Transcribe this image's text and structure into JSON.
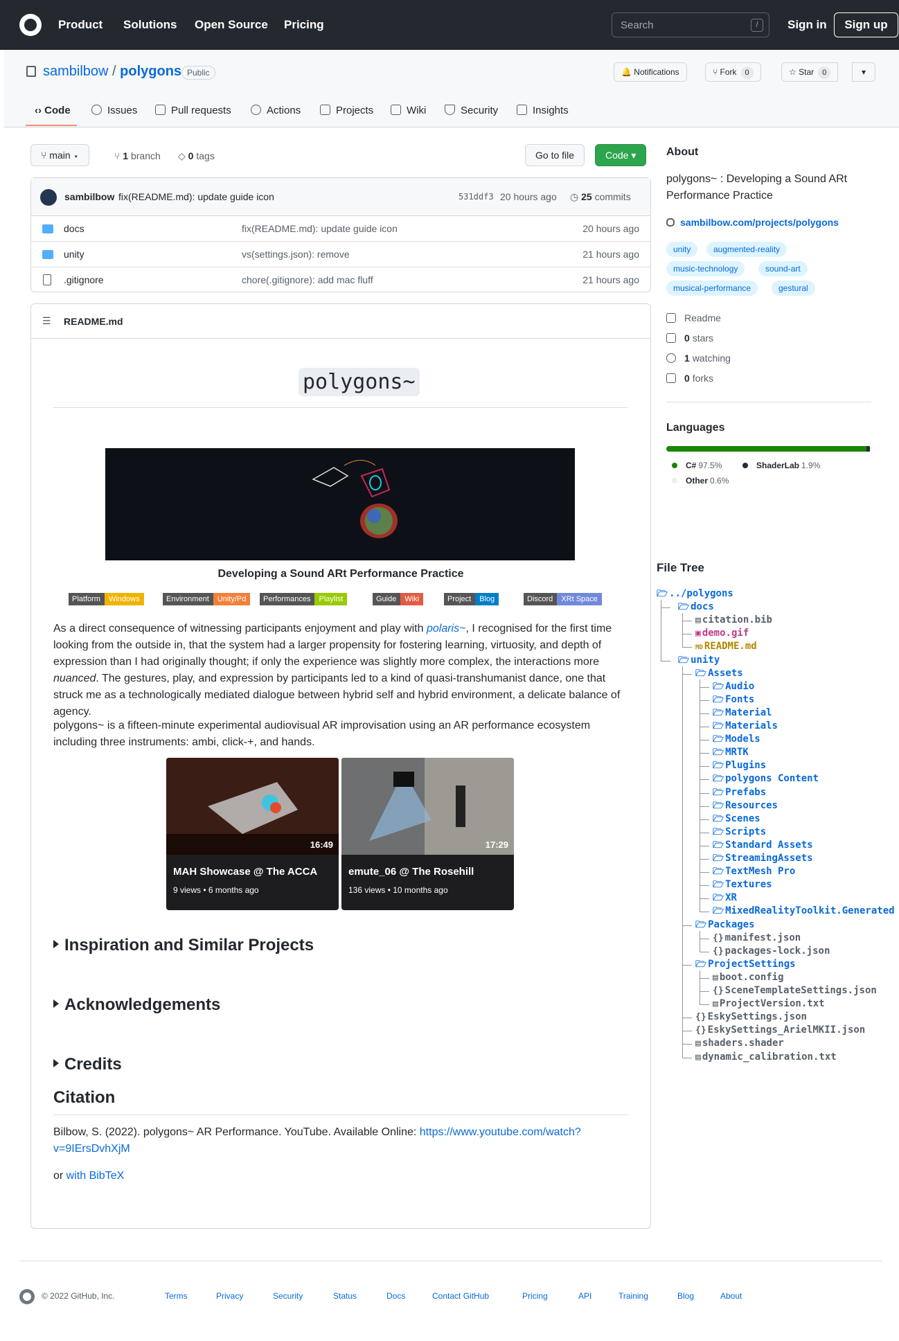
{
  "topnav": {
    "items": [
      "Product",
      "Solutions",
      "Open Source",
      "Pricing"
    ],
    "search_placeholder": "Search",
    "search_shortcut": "/",
    "signin": "Sign in",
    "signup": "Sign up"
  },
  "repo": {
    "owner": "sambilbow",
    "separator": "/",
    "name": "polygons",
    "visibility": "Public",
    "notifications": "Notifications",
    "fork_label": "Fork",
    "fork_count": "0",
    "star_label": "Star",
    "star_count": "0",
    "tabs": [
      "Code",
      "Issues",
      "Pull requests",
      "Actions",
      "Projects",
      "Wiki",
      "Security",
      "Insights"
    ]
  },
  "branchbar": {
    "branch": "main",
    "branches_count": "1",
    "branches_label": "branch",
    "tags_count": "0",
    "tags_label": "tags",
    "go_to_file": "Go to file",
    "code_button": "Code"
  },
  "latest_commit": {
    "author": "sambilbow",
    "message": "fix(README.md): update guide icon",
    "sha": "531ddf3",
    "time": "20 hours ago",
    "commits_count": "25",
    "commits_label": "commits"
  },
  "files": [
    {
      "name": "docs",
      "message": "fix(README.md): update guide icon",
      "time": "20 hours ago"
    },
    {
      "name": "unity",
      "message": "vs(settings.json): remove",
      "time": "21 hours ago"
    },
    {
      "name": ".gitignore",
      "message": "chore(.gitignore): add mac fluff",
      "time": "21 hours ago"
    }
  ],
  "readme": {
    "filename": "README.md",
    "title": "polygons~",
    "subtitle": "Developing a Sound ARt Performance Practice",
    "badges": [
      {
        "left": "Platform",
        "right": "Windows",
        "color": "#f0b400"
      },
      {
        "left": "Environment",
        "right": "Unity/Pd",
        "color": "#f1803a"
      },
      {
        "left": "Performances",
        "right": "Playlist",
        "color": "#97ca00"
      },
      {
        "left": "Guide",
        "right": "Wiki",
        "color": "#e05d44"
      },
      {
        "left": "Project",
        "right": "Blog",
        "color": "#007ec6"
      },
      {
        "left": "Discord",
        "right": "XRt Space",
        "color": "#7289da"
      }
    ],
    "para1_a": "As a direct consequence of witnessing participants enjoyment and play with ",
    "para1_link": "polaris~",
    "para1_b": ", I recognised for the first time looking from the outside in, that the system had a larger propensity for fostering learning, virtuosity, and depth of expression than I had originally thought; if only the experience was slightly more complex, the interactions more ",
    "para1_em": "nuanced",
    "para1_c": ". The gestures, play, and expression by participants led to a kind of quasi-transhumanist dance, one that struck me as a technologically mediated dialogue between hybrid self and hybrid environment, a delicate balance of agency.",
    "para2": "polygons~ is a fifteen-minute experimental audiovisual AR improvisation using an AR performance ecosystem including three instruments: ambi, click-+, and hands.",
    "videos": [
      {
        "title": "MAH Showcase @ The ACCA",
        "duration": "16:49",
        "views": "9 views",
        "age": "6 months ago"
      },
      {
        "title": "emute_06 @ The Rosehill",
        "duration": "17:29",
        "views": "136 views",
        "age": "10 months ago"
      }
    ],
    "details": [
      "Inspiration and Similar Projects",
      "Acknowledgements",
      "Credits"
    ],
    "citation_heading": "Citation",
    "citation_text": "Bilbow, S. (2022). polygons~ AR Performance. YouTube. Available Online: ",
    "citation_url": "https://www.youtube.com/watch?v=9IErsDvhXjM",
    "bib_prefix": "or ",
    "bib_link": "with BibTeX"
  },
  "about": {
    "heading": "About",
    "description": "polygons~ : Developing a Sound ARt Performance Practice",
    "website": "sambilbow.com/projects/polygons",
    "topics": [
      "unity",
      "augmented-reality",
      "music-technology",
      "sound-art",
      "musical-performance",
      "gestural"
    ],
    "readme": "Readme",
    "stars_count": "0",
    "stars_label": "stars",
    "watching_count": "1",
    "watching_label": "watching",
    "forks_count": "0",
    "forks_label": "forks"
  },
  "languages": {
    "heading": "Languages",
    "items": [
      {
        "name": "C#",
        "percent": "97.5%",
        "value": 97.5,
        "color": "#178600"
      },
      {
        "name": "ShaderLab",
        "percent": "1.9%",
        "value": 1.9,
        "color": "#222c37"
      },
      {
        "name": "Other",
        "percent": "0.6%",
        "value": 0.6,
        "color": "#ededed"
      }
    ]
  },
  "file_tree": {
    "heading": "File Tree",
    "lines": [
      {
        "depth": 0,
        "type": "dir",
        "name": "../polygons"
      },
      {
        "depth": 1,
        "type": "dir",
        "name": "docs"
      },
      {
        "depth": 2,
        "type": "file",
        "name": "citation.bib"
      },
      {
        "depth": 2,
        "type": "media",
        "name": "demo.gif"
      },
      {
        "depth": 2,
        "type": "md",
        "name": "README.md"
      },
      {
        "depth": 1,
        "type": "dir",
        "name": "unity"
      },
      {
        "depth": 2,
        "type": "dir",
        "name": "Assets"
      },
      {
        "depth": 3,
        "type": "dir",
        "name": "Audio"
      },
      {
        "depth": 3,
        "type": "dir",
        "name": "Fonts"
      },
      {
        "depth": 3,
        "type": "dir",
        "name": "Material"
      },
      {
        "depth": 3,
        "type": "dir",
        "name": "Materials"
      },
      {
        "depth": 3,
        "type": "dir",
        "name": "Models"
      },
      {
        "depth": 3,
        "type": "dir",
        "name": "MRTK"
      },
      {
        "depth": 3,
        "type": "dir",
        "name": "Plugins"
      },
      {
        "depth": 3,
        "type": "dir",
        "name": "polygons Content"
      },
      {
        "depth": 3,
        "type": "dir",
        "name": "Prefabs"
      },
      {
        "depth": 3,
        "type": "dir",
        "name": "Resources"
      },
      {
        "depth": 3,
        "type": "dir",
        "name": "Scenes"
      },
      {
        "depth": 3,
        "type": "dir",
        "name": "Scripts"
      },
      {
        "depth": 3,
        "type": "dir",
        "name": "Standard Assets"
      },
      {
        "depth": 3,
        "type": "dir",
        "name": "StreamingAssets"
      },
      {
        "depth": 3,
        "type": "dir",
        "name": "TextMesh Pro"
      },
      {
        "depth": 3,
        "type": "dir",
        "name": "Textures"
      },
      {
        "depth": 3,
        "type": "dir",
        "name": "XR"
      },
      {
        "depth": 3,
        "type": "dir",
        "name": "MixedRealityToolkit.Generated"
      },
      {
        "depth": 2,
        "type": "dir",
        "name": "Packages"
      },
      {
        "depth": 3,
        "type": "json",
        "name": "manifest.json"
      },
      {
        "depth": 3,
        "type": "json",
        "name": "packages-lock.json"
      },
      {
        "depth": 2,
        "type": "dir",
        "name": "ProjectSettings"
      },
      {
        "depth": 3,
        "type": "file",
        "name": "boot.config"
      },
      {
        "depth": 3,
        "type": "json",
        "name": "SceneTemplateSettings.json"
      },
      {
        "depth": 3,
        "type": "file",
        "name": "ProjectVersion.txt"
      },
      {
        "depth": 2,
        "type": "json",
        "name": "EskySettings.json"
      },
      {
        "depth": 2,
        "type": "json",
        "name": "EskySettings_ArielMKII.json"
      },
      {
        "depth": 2,
        "type": "file",
        "name": "shaders.shader"
      },
      {
        "depth": 2,
        "type": "file",
        "name": "dynamic_calibration.txt"
      }
    ]
  },
  "footer": {
    "copyright": "© 2022 GitHub, Inc.",
    "links": [
      "Terms",
      "Privacy",
      "Security",
      "Status",
      "Docs",
      "Contact GitHub",
      "Pricing",
      "API",
      "Training",
      "Blog",
      "About"
    ]
  }
}
